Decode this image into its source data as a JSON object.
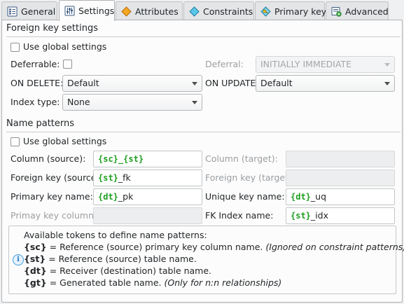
{
  "tabs": [
    {
      "label": "General",
      "icon": "general-icon"
    },
    {
      "label": "Settings",
      "icon": "settings-icon"
    },
    {
      "label": "Attributes",
      "icon": "attributes-icon"
    },
    {
      "label": "Constraints",
      "icon": "constraints-icon"
    },
    {
      "label": "Primary key",
      "icon": "primary-key-icon"
    },
    {
      "label": "Advanced",
      "icon": "advanced-icon"
    }
  ],
  "active_tab": "Settings",
  "fk": {
    "title": "Foreign key settings",
    "use_global": "Use global settings",
    "deferrable": "Deferrable:",
    "deferral_label": "Deferral:",
    "deferral_value": "INITIALLY IMMEDIATE",
    "on_delete_label": "ON DELETE:",
    "on_delete_value": "Default",
    "on_update_label": "ON UPDATE:",
    "on_update_value": "Default",
    "index_type_label": "Index type:",
    "index_type_value": "None"
  },
  "np": {
    "title": "Name patterns",
    "use_global": "Use global settings",
    "col_source_label": "Column (source):",
    "col_source_tok1": "{sc}",
    "col_source_sep": "_",
    "col_source_tok2": "{st}",
    "col_target_label": "Column (target):",
    "fk_source_label": "Foreign key (source):",
    "fk_source_tok": "{st}",
    "fk_source_suffix": "_fk",
    "fk_target_label": "Foreign key (target):",
    "pk_name_label": "Primary key name:",
    "pk_name_tok": "{dt}",
    "pk_name_suffix": "_pk",
    "uq_label": "Unique key name:",
    "uq_tok": "{dt}",
    "uq_suffix": "_uq",
    "pk_col_label": "Primay key column:",
    "fkidx_label": "FK Index name:",
    "fkidx_tok": "{st}",
    "fkidx_suffix": "_idx"
  },
  "info": {
    "heading": "Available tokens to define name patterns:",
    "lines": [
      {
        "token": "{sc}",
        "text": " = Reference (source) primary key column name. ",
        "note": "(Ignored on constraint patterns)"
      },
      {
        "token": "{st}",
        "text": " = Reference (source) table name.",
        "note": ""
      },
      {
        "token": "{dt}",
        "text": " = Receiver (destination) table name.",
        "note": ""
      },
      {
        "token": "{gt}",
        "text": " = Generated table name. ",
        "note": "(Only for n:n relationships)"
      }
    ]
  },
  "colors": {
    "token": "#1f9e1f",
    "info_icon": "#2377c4",
    "panel": "#fcfcfc"
  }
}
